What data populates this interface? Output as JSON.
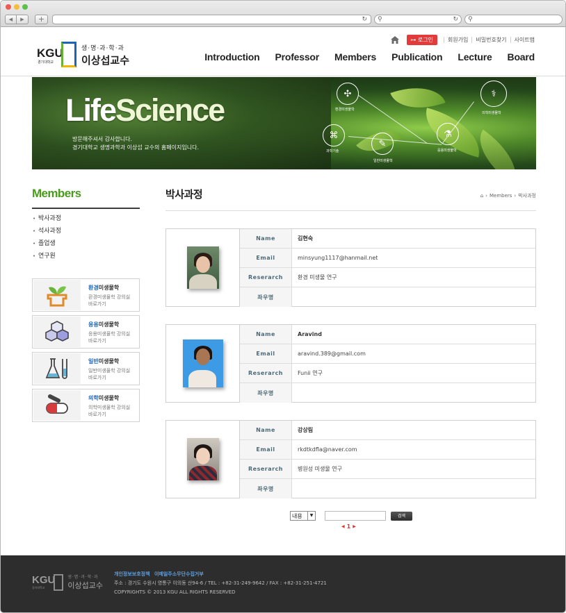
{
  "header": {
    "logo_kgu": "KGU",
    "logo_sub": "경기대학교",
    "logo_dept": "생·명·과·학·과",
    "logo_name": "이상섭교수",
    "login": "로그인",
    "util_links": [
      "회원가입",
      "비밀번호찾기",
      "사이트맵"
    ],
    "nav": [
      "Introduction",
      "Professor",
      "Members",
      "Publication",
      "Lecture",
      "Board"
    ]
  },
  "banner": {
    "title_a": "Life",
    "title_b": "Science",
    "desc_1": "방문해주셔서 감사합니다.",
    "desc_2": "경기대학교 생명과학과 이상섭 교수의 홈페이지입니다.",
    "labels": [
      "환경미생물학",
      "의학미생물학",
      "과학기술",
      "응용미생물학",
      "일반미생물학"
    ]
  },
  "sidebar": {
    "title": "Members",
    "items": [
      "박사과정",
      "석사과정",
      "졸업생",
      "연구원"
    ],
    "quick": [
      {
        "hl": "환경",
        "rest": "미생물학",
        "desc1": "환경미생물학 강의실",
        "desc2": "바로가기"
      },
      {
        "hl": "응용",
        "rest": "미생물학",
        "desc1": "응용미생물학 강의실",
        "desc2": "바로가기"
      },
      {
        "hl": "일반",
        "rest": "미생물학",
        "desc1": "일반미생물학 강의실",
        "desc2": "바로가기"
      },
      {
        "hl": "의학",
        "rest": "미생물학",
        "desc1": "의학미생물학 강의실",
        "desc2": "바로가기"
      }
    ]
  },
  "main": {
    "title": "박사과정",
    "breadcrumb": [
      "Members",
      "박사과정"
    ],
    "labels": {
      "name": "Name",
      "email": "Email",
      "research": "Reserarch",
      "motto": "좌우명"
    },
    "people": [
      {
        "name": "김현숙",
        "email": "minsyung1117@hanmail.net",
        "research": "환경 미생물 연구",
        "motto": ""
      },
      {
        "name": "Aravind",
        "email": "aravind.389@gmail.com",
        "research": "Funii 연구",
        "motto": ""
      },
      {
        "name": "강상림",
        "email": "rkdtkdfla@naver.com",
        "research": "병원성 미생물 연구",
        "motto": ""
      }
    ]
  },
  "search": {
    "select_value": "내용",
    "button": "검색",
    "page": "1"
  },
  "footer": {
    "logo_kgu": "KGU",
    "logo_sub": "경기대학교",
    "logo_dept": "생·명·과·학·과",
    "logo_name": "이상섭교수",
    "link_1": "개인정보보호정책",
    "link_2": "이메일주소무단수집거부",
    "address": "주소 : 경기도 수원시 영통구 이의동 산94-6 /  TEL : +82-31-249-9642 /  FAX : +82-31-251-4721",
    "copyright": "COPYRIGHTS © 2013 KGU  ALL RIGHTS RESERVED"
  }
}
